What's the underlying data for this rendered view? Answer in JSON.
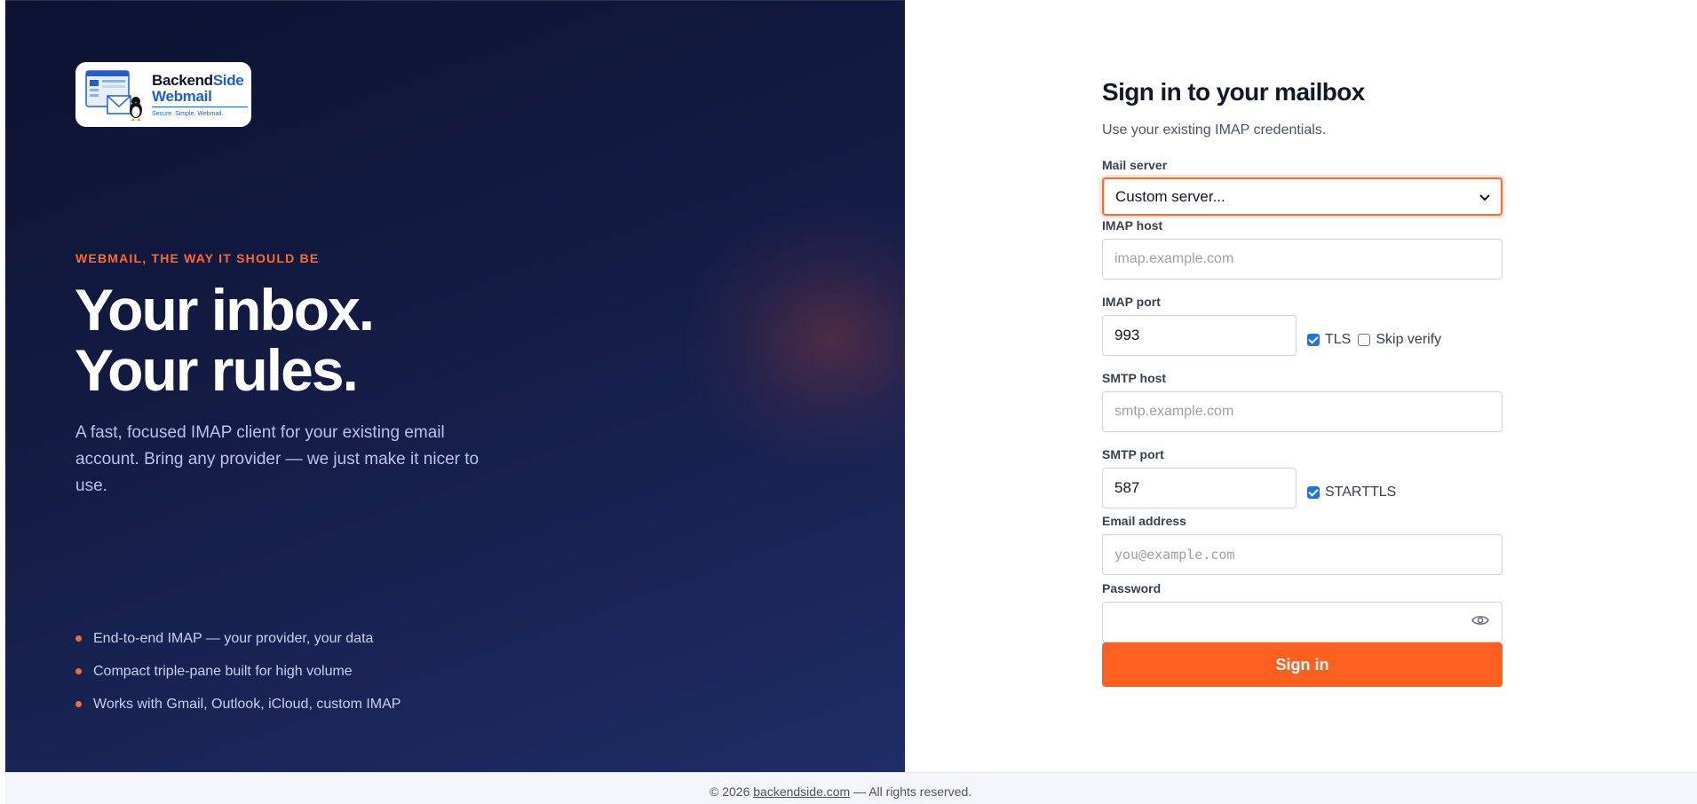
{
  "brand": {
    "name_part1": "Backend",
    "name_part2": "Side",
    "name_line2": "Webmail",
    "tagline": "Secure. Simple. Webmail."
  },
  "hero": {
    "eyebrow": "WEBMAIL, THE WAY IT SHOULD BE",
    "headline_line1": "Your inbox.",
    "headline_line2": "Your rules.",
    "lede": "A fast, focused IMAP client for your existing email account. Bring any provider — we just make it nicer to use.",
    "features": [
      "End-to-end IMAP — your provider, your data",
      "Compact triple-pane built for high volume",
      "Works with Gmail, Outlook, iCloud, custom IMAP"
    ]
  },
  "form": {
    "title": "Sign in to your mailbox",
    "subtitle": "Use your existing IMAP credentials.",
    "mail_server_label": "Mail server",
    "mail_server_value": "Custom server...",
    "imap_host_label": "IMAP host",
    "imap_host_placeholder": "imap.example.com",
    "imap_port_label": "IMAP port",
    "imap_port_value": "993",
    "tls_label": "TLS",
    "tls_checked": true,
    "skip_verify_label": "Skip verify",
    "skip_verify_checked": false,
    "smtp_host_label": "SMTP host",
    "smtp_host_placeholder": "smtp.example.com",
    "smtp_port_label": "SMTP port",
    "smtp_port_value": "587",
    "starttls_label": "STARTTLS",
    "starttls_checked": true,
    "email_label": "Email address",
    "email_placeholder": "you@example.com",
    "password_label": "Password",
    "password_value": "",
    "submit_label": "Sign in"
  },
  "footer": {
    "prefix": "© 2026 ",
    "link": "backendside.com",
    "suffix": " — All rights reserved."
  },
  "colors": {
    "accent": "#ff5f1f",
    "hero_bg": "#141c45",
    "brand_blue": "#1d5fd6",
    "checkbox": "#1a73e8"
  },
  "icons": {
    "select_chevron": "chevron-down-icon",
    "password_toggle": "eye-icon",
    "feature_bullet": "dot-icon"
  }
}
